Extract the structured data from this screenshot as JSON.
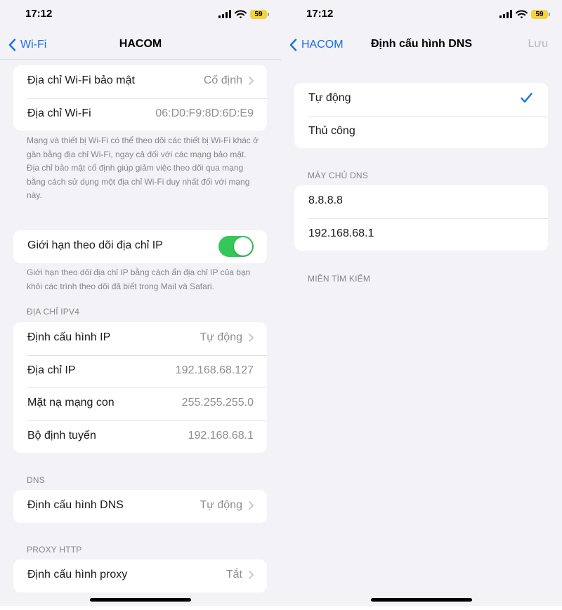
{
  "status_bar": {
    "time": "17:12",
    "battery": "59"
  },
  "left": {
    "nav": {
      "back_label": "Wi-Fi",
      "title": "HACOM"
    },
    "private_address": {
      "rows": [
        {
          "label": "Địa chỉ Wi-Fi bảo mật",
          "value": "Cố định"
        },
        {
          "label": "Địa chỉ Wi-Fi",
          "value": "06:D0:F9:8D:6D:E9"
        }
      ],
      "note_line1": "Mạng và thiết bị Wi-Fi có thể theo dõi các thiết bị Wi-Fi khác ở gần bằng địa chỉ Wi-Fi, ngay cả đối với các mạng bảo mật.",
      "note_line2": "Địa chỉ bảo mật cố định giúp giảm việc theo dõi qua mạng bằng cách sử dụng một địa chỉ Wi-Fi duy nhất đối với mạng này."
    },
    "limit_ip": {
      "label": "Giới hạn theo dõi địa chỉ IP",
      "enabled": true,
      "note": "Giới hạn theo dõi địa chỉ IP bằng cách ẩn địa chỉ IP của bạn khỏi các trình theo dõi đã biết trong Mail và Safari."
    },
    "ipv4": {
      "header": "ĐỊA CHỈ IPV4",
      "rows": [
        {
          "label": "Định cấu hình IP",
          "value": "Tự động"
        },
        {
          "label": "Địa chỉ IP",
          "value": "192.168.68.127"
        },
        {
          "label": "Mặt nạ mạng con",
          "value": "255.255.255.0"
        },
        {
          "label": "Bộ định tuyến",
          "value": "192.168.68.1"
        }
      ]
    },
    "dns": {
      "header": "DNS",
      "row": {
        "label": "Định cấu hình DNS",
        "value": "Tự động"
      }
    },
    "proxy": {
      "header": "PROXY HTTP",
      "row": {
        "label": "Định cấu hình proxy",
        "value": "Tắt"
      }
    }
  },
  "right": {
    "nav": {
      "back_label": "HACOM",
      "title": "Định cấu hình DNS",
      "save_label": "Lưu"
    },
    "modes": [
      {
        "label": "Tự động",
        "selected": true
      },
      {
        "label": "Thủ công",
        "selected": false
      }
    ],
    "dns_servers": {
      "header": "MÁY CHỦ DNS",
      "servers": [
        "8.8.8.8",
        "192.168.68.1"
      ]
    },
    "search_domains": {
      "header": "MIỀN TÌM KIẾM"
    }
  },
  "colors": {
    "accent": "#1a6fe0",
    "toggle_on": "#34c759",
    "battery": "#f5d33b"
  },
  "icons": [
    "chevron-left-icon",
    "chevron-right-icon",
    "checkmark-icon",
    "signal-icon",
    "wifi-icon",
    "battery-icon"
  ]
}
